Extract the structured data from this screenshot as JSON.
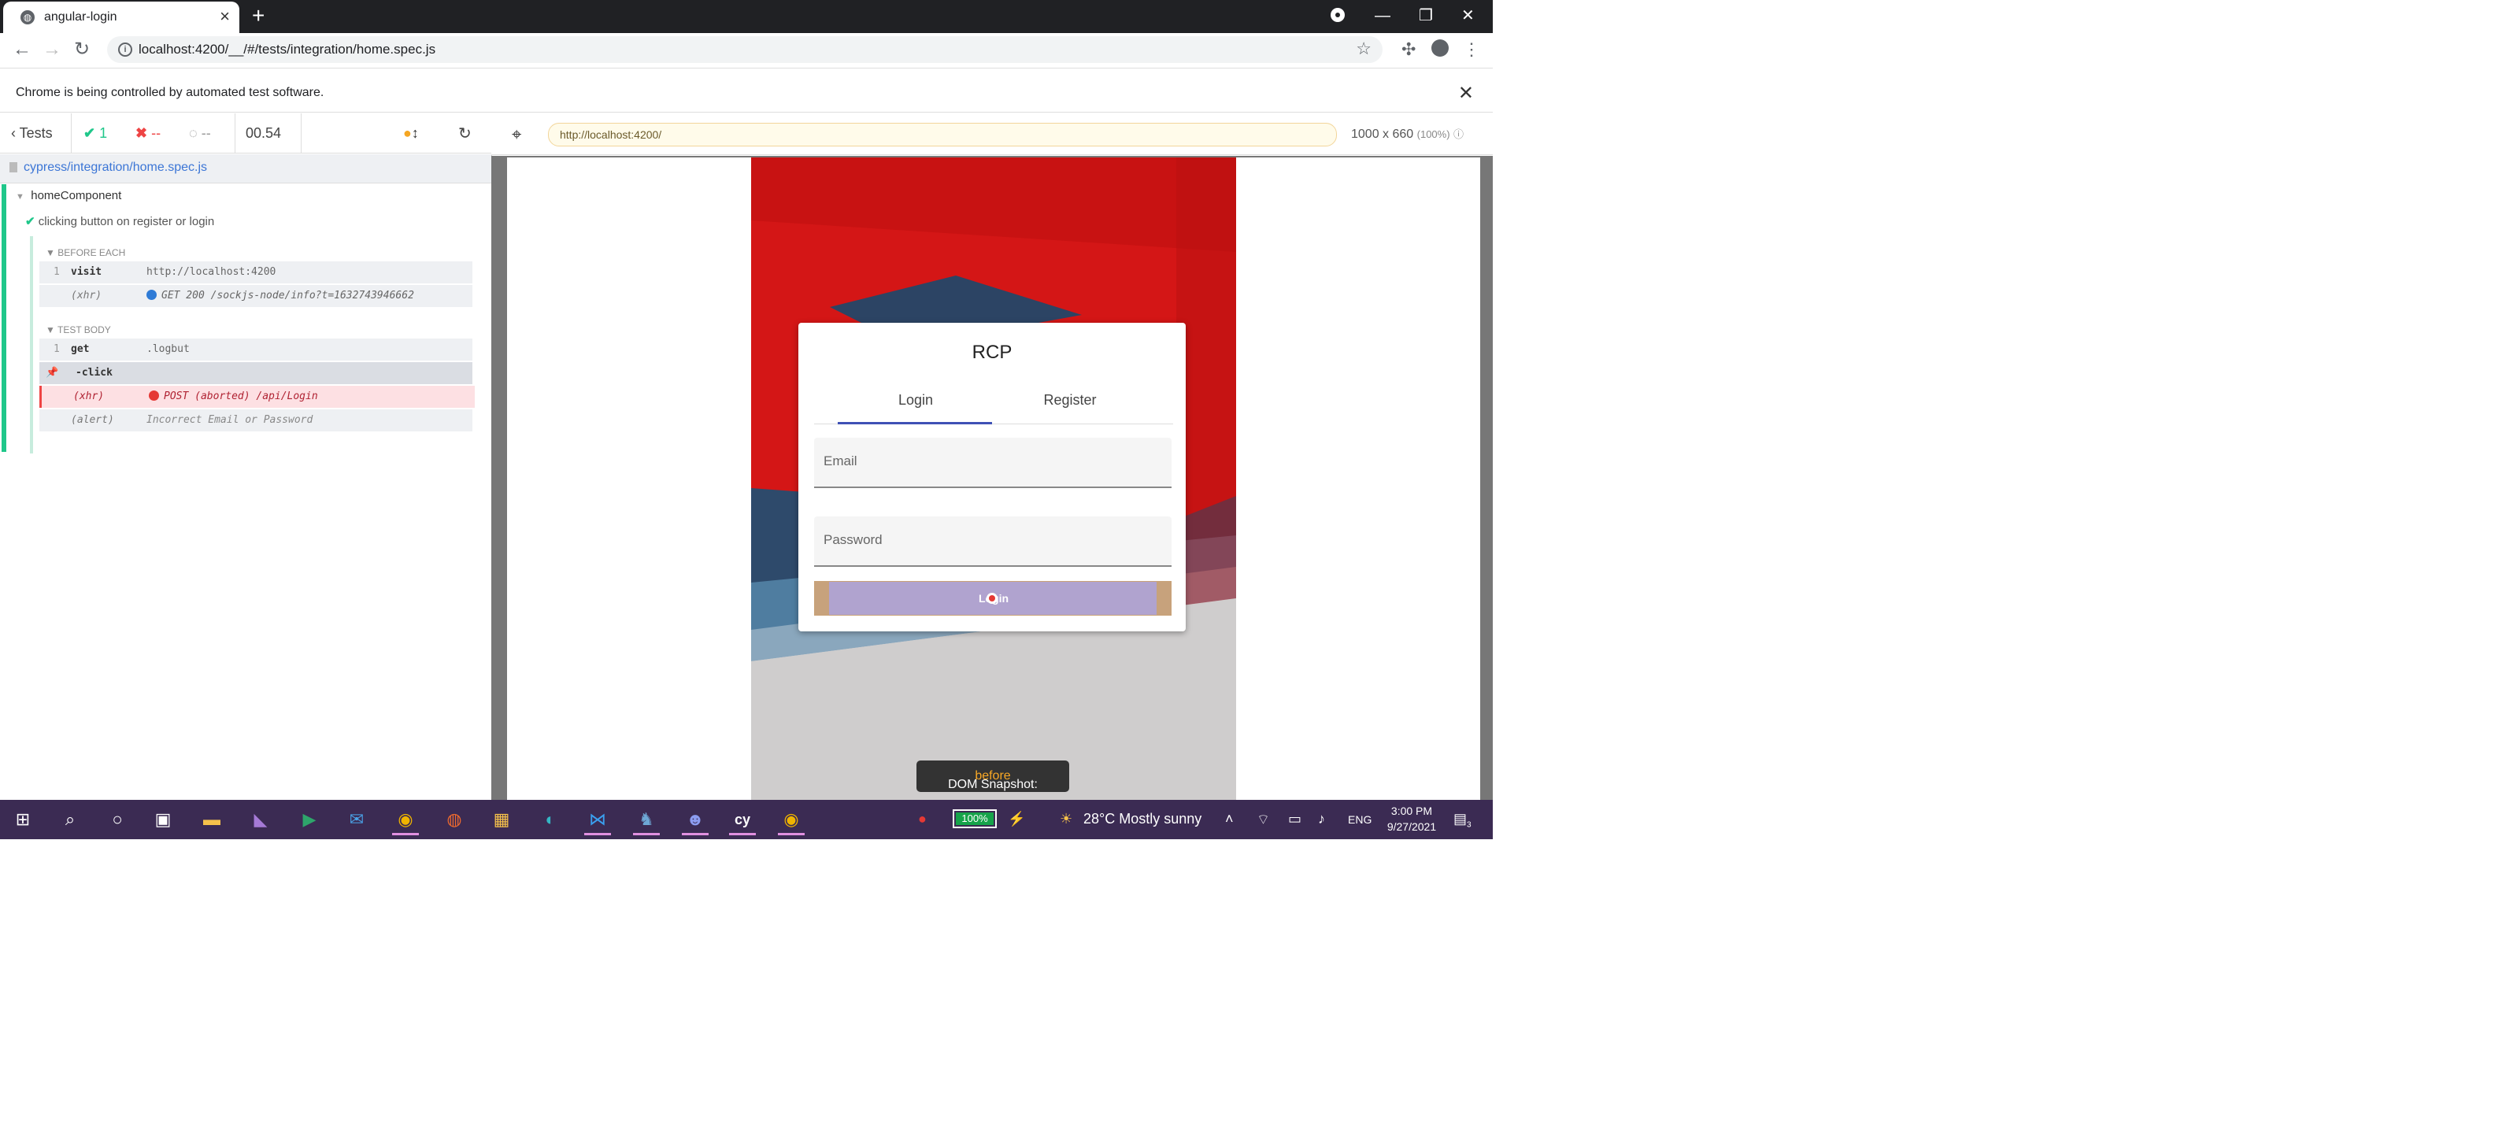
{
  "browser": {
    "tab_title": "angular-login",
    "url": "localhost:4200/__/#/tests/integration/home.spec.js",
    "infobar": "Chrome is being controlled by automated test software."
  },
  "reporter": {
    "tests_label": "Tests",
    "passed": "1",
    "failed": "--",
    "pending": "--",
    "duration": "00.54",
    "spec_file": "cypress/integration/home.spec.js",
    "suite": "homeComponent",
    "test": "clicking button on register or login",
    "before_each_label": "BEFORE EACH",
    "test_body_label": "TEST BODY",
    "commands": [
      {
        "num": "1",
        "name": "visit",
        "arg": "http://localhost:4200"
      },
      {
        "num": "",
        "name": "(xhr)",
        "arg": "GET 200 /sockjs-node/info?t=1632743946662"
      },
      {
        "num": "1",
        "name": "get",
        "arg": ".logbut"
      },
      {
        "num": "",
        "name": "-click",
        "arg": ""
      },
      {
        "num": "",
        "name": "(xhr)",
        "arg": "POST (aborted) /api/Login"
      },
      {
        "num": "",
        "name": "(alert)",
        "arg": "Incorrect Email or Password"
      }
    ]
  },
  "aut": {
    "url": "http://localhost:4200/",
    "viewport": "1000 x 660",
    "zoom": "(100%)",
    "snapshot_prefix": "DOM Snapshot:",
    "snapshot_state": "before"
  },
  "app": {
    "title": "RCP",
    "tabs": [
      "Login",
      "Register"
    ],
    "email_placeholder": "Email",
    "password_placeholder": "Password",
    "login_button": "Login"
  },
  "taskbar": {
    "battery": "100%",
    "weather": "28°C  Mostly sunny",
    "language": "ENG",
    "time": "3:00 PM",
    "date": "9/27/2021",
    "notifications": "3"
  },
  "colors": {
    "passed": "#1fc78a",
    "failed": "#e44",
    "tab_ink": "#3f51b5",
    "taskbar": "#3b2b53"
  }
}
